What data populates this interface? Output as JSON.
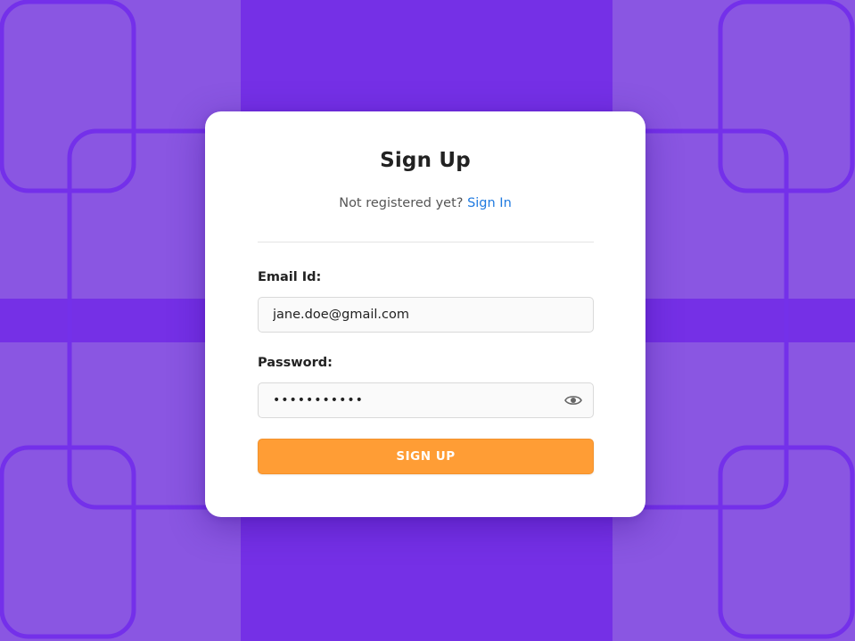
{
  "form": {
    "title": "Sign Up",
    "subtitle_text": "Not registered yet?",
    "signin_link": "Sign In",
    "email_label": "Email Id:",
    "email_value": "jane.doe@gmail.com",
    "password_label": "Password:",
    "password_value": "•••••••••••",
    "submit_label": "SIGN UP",
    "reveal_icon": "eye-icon"
  },
  "colors": {
    "background_light": "#8a56e2",
    "background_dark": "#7530e6",
    "pattern_stroke": "#7430ea",
    "link": "#1f7ae0",
    "button": "#ff9d35",
    "card": "#ffffff"
  }
}
